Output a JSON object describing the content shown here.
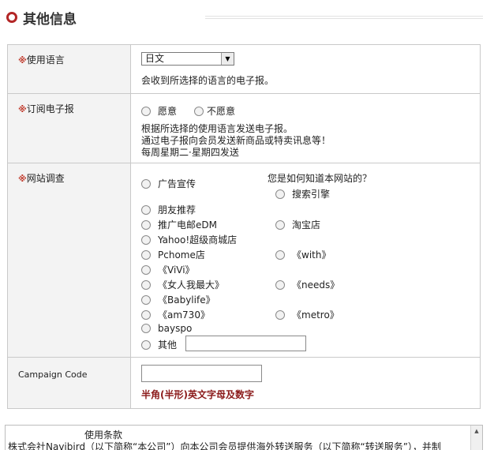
{
  "section_title": "其他信息",
  "language": {
    "label": "使用语言",
    "selected": "日文",
    "note": "会收到所选择的语言的电子报。"
  },
  "newsletter": {
    "label": "订阅电子报",
    "options": [
      "愿意",
      "不愿意"
    ],
    "note_lines": [
      "根据所选择的使用语言发送电子报。",
      "通过电子报向会员发送新商品或特卖讯息等！",
      "每周星期二·星期四发送"
    ]
  },
  "survey": {
    "label": "网站调查",
    "question": "您是如何知道本网站的？",
    "left_options": [
      "广告宣传",
      "朋友推荐",
      "推广电邮eDM",
      "Yahoo!超级商城店",
      "Pchome店",
      "《ViVi》",
      "《女人我最大》",
      "《Babylife》",
      "《am730》",
      "bayspo",
      "其他"
    ],
    "right_options": [
      "搜索引擎",
      "淘宝店",
      "《with》",
      "《needs》",
      "《metro》"
    ]
  },
  "campaign": {
    "label": "Campaign Code",
    "hint": "半角(半形)英文字母及数字"
  },
  "terms": {
    "heading": "使用条款",
    "line1": "株式会社Navibird（以下简称“本公司”）向本公司会员提供海外转送服务（以下简称“转送服务”），并制"
  },
  "mark": "※"
}
